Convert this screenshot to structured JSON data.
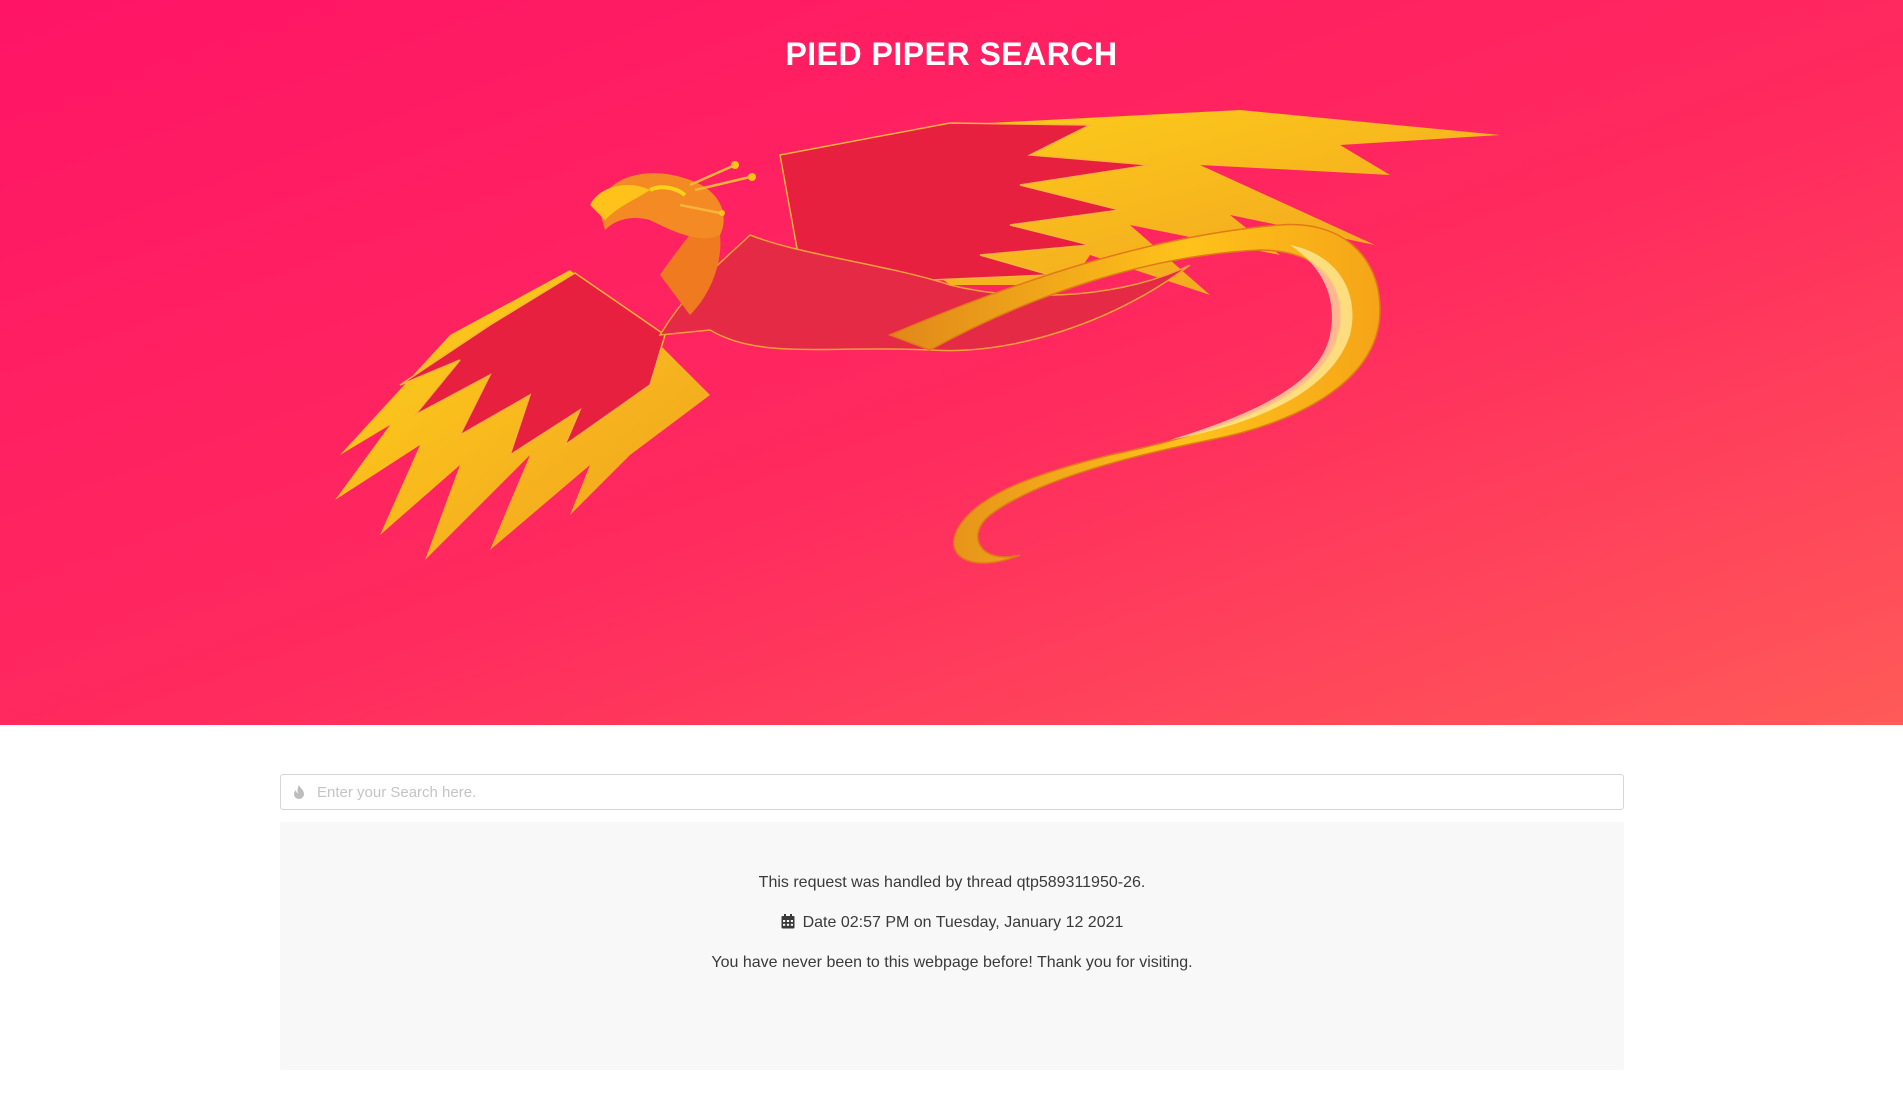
{
  "header": {
    "title": "PIED PIPER SEARCH",
    "logo_icon": "phoenix-logo"
  },
  "search": {
    "icon": "flame-icon",
    "placeholder": "Enter your Search here.",
    "value": ""
  },
  "info": {
    "thread_text": "This request was handled by thread qtp589311950-26.",
    "date_icon": "calendar-icon",
    "date_text": "Date 02:57 PM on Tuesday, January 12 2021",
    "visit_text": "You have never been to this webpage before! Thank you for visiting."
  },
  "colors": {
    "hero_start": "#ff1466",
    "hero_end": "#ff5a58",
    "panel_bg": "#f8f8f8"
  }
}
